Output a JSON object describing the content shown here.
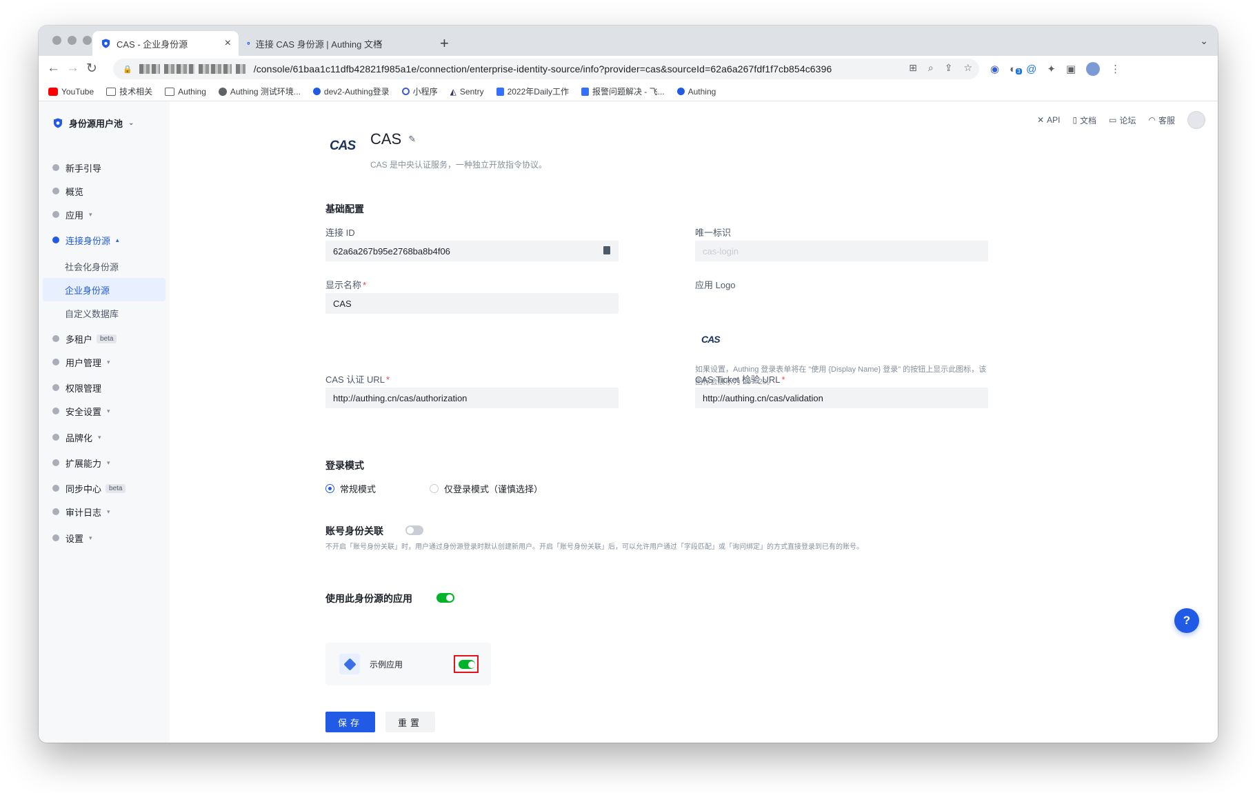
{
  "browser": {
    "tabs": [
      {
        "title": "CAS - 企业身份源",
        "close": "×"
      },
      {
        "title": "连接 CAS 身份源 | Authing 文档",
        "close": "×"
      }
    ],
    "new_tab": "+",
    "url_path": "/console/61baa1c11dfb42821f985a1e/connection/enterprise-identity-source/info?provider=cas&sourceId=62a6a267fdf1f7cb854c6396",
    "bookmarks": [
      "YouTube",
      "技术相关",
      "Authing",
      "Authing 测试环境...",
      "dev2-Authing登录",
      "小程序",
      "Sentry",
      "2022年Daily工作",
      "报警问题解决 - 飞...",
      "Authing"
    ],
    "extension_badge": "3"
  },
  "sidebar": {
    "pool_name": "身份源用户池",
    "items": [
      {
        "label": "新手引导"
      },
      {
        "label": "概览"
      },
      {
        "label": "应用"
      },
      {
        "label": "连接身份源"
      },
      {
        "label": "社会化身份源"
      },
      {
        "label": "企业身份源"
      },
      {
        "label": "自定义数据库"
      },
      {
        "label": "多租户",
        "badge": "beta"
      },
      {
        "label": "用户管理"
      },
      {
        "label": "权限管理"
      },
      {
        "label": "安全设置"
      },
      {
        "label": "品牌化"
      },
      {
        "label": "扩展能力"
      },
      {
        "label": "同步中心",
        "badge": "beta"
      },
      {
        "label": "审计日志"
      },
      {
        "label": "设置"
      }
    ]
  },
  "topbar": {
    "api": "API",
    "docs": "文档",
    "forum": "论坛",
    "support": "客服"
  },
  "page": {
    "logo_text": "CAS",
    "title": "CAS",
    "description": "CAS 是中央认证服务，一种独立开放指令协议。",
    "basic_config_title": "基础配置",
    "connection_id_label": "连接 ID",
    "connection_id_value": "62a6a267b95e2768ba8b4f06",
    "unique_id_label": "唯一标识",
    "unique_id_value": "cas-login",
    "display_name_label": "显示名称",
    "display_name_value": "CAS",
    "app_logo_label": "应用 Logo",
    "app_logo_text": "CAS",
    "logo_hint": "如果设置，Authing 登录表单将在 \"使用 {Display Name} 登录\" 的按钮上显示此图标，该图标会展示为 20 * 20。",
    "cas_auth_url_label": "CAS 认证 URL",
    "cas_auth_url_value": "http://authing.cn/cas/authorization",
    "cas_ticket_url_label": "CAS Ticket 检验 URL",
    "cas_ticket_url_value": "http://authing.cn/cas/validation",
    "login_mode_title": "登录模式",
    "login_mode_options": [
      "常规模式",
      "仅登录模式（谨慎选择）"
    ],
    "login_mode_selected": "常规模式",
    "account_link_title": "账号身份关联",
    "account_link_enabled": false,
    "account_link_desc": "不开启「账号身份关联」时，用户通过身份源登录时默认创建新用户。开启「账号身份关联」后，可以允许用户通过「字段匹配」或「询问绑定」的方式直接登录到已有的账号。",
    "apps_title": "使用此身份源的应用",
    "apps_enabled": true,
    "apps": [
      {
        "name": "示例应用",
        "enabled": true
      }
    ],
    "save_label": "保存",
    "reset_label": "重置",
    "help_label": "?"
  },
  "colors": {
    "primary": "#215ae5",
    "switch_on": "#00b42a",
    "highlight": "#e4131b"
  }
}
